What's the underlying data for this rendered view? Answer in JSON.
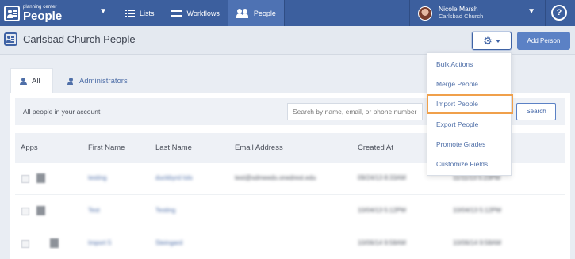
{
  "app": {
    "brand_small": "planning center",
    "brand_name": "People"
  },
  "nav": [
    {
      "label": "Lists",
      "icon": "list-icon"
    },
    {
      "label": "Workflows",
      "icon": "workflows-icon"
    },
    {
      "label": "People",
      "icon": "people-icon",
      "active": true
    }
  ],
  "user": {
    "name": "Nicole Marsh",
    "org": "Carlsbad Church"
  },
  "help_label": "?",
  "page": {
    "title": "Carlsbad Church People",
    "add_button": "Add Person",
    "gear_icon": "⚙"
  },
  "tabs": {
    "all": "All",
    "admins": "Administrators"
  },
  "search": {
    "label": "All people in your account",
    "placeholder": "Search by name, email, or phone number",
    "button": "Search"
  },
  "columns": {
    "apps": "Apps",
    "first": "First Name",
    "last": "Last Name",
    "email": "Email Address",
    "created": "Created At"
  },
  "rows": [
    {
      "first": "testing",
      "last": "duckbyrd lols",
      "email": "test@sdmeeds.onedrest.edu",
      "created": "09/24/13 8:33AM",
      "extra": "11/11/13 5:23PM"
    },
    {
      "first": "Test",
      "last": "Testing",
      "email": "",
      "created": "10/04/13 5:12PM",
      "extra": "10/04/13 5:12PM"
    },
    {
      "first": "Import 5",
      "last": "Steingard",
      "email": "",
      "created": "10/06/14 9:58AM",
      "extra": "10/06/14 9:58AM"
    }
  ],
  "menu": {
    "items": [
      "Bulk Actions",
      "Merge People",
      "Import People",
      "Export People",
      "Promote Grades",
      "Customize Fields"
    ],
    "highlighted_index": 2
  },
  "colors": {
    "nav_bg": "#3c5f9e",
    "accent": "#5b81c5",
    "highlight": "#f0a04b"
  }
}
